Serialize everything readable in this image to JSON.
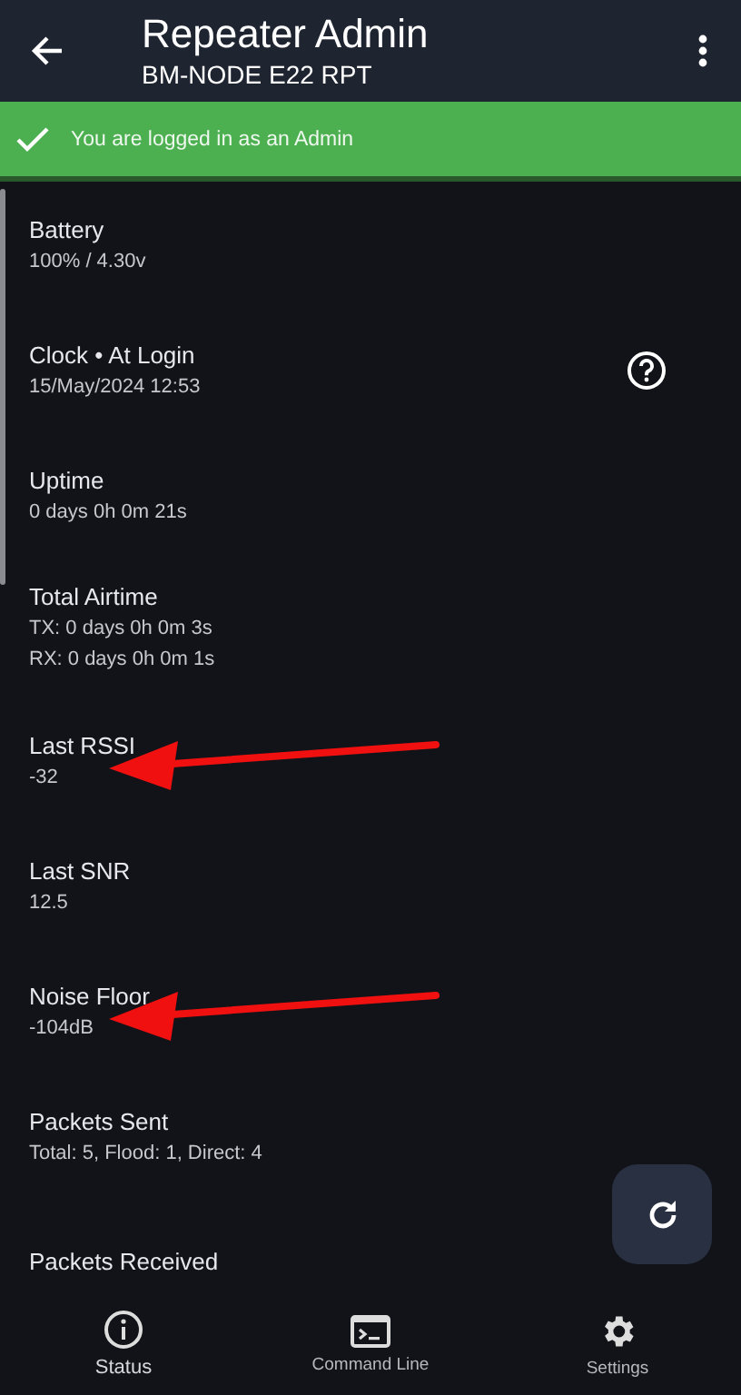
{
  "app_bar": {
    "title": "Repeater Admin",
    "subtitle": "BM-NODE E22 RPT"
  },
  "banner": {
    "text": "You are logged in as an Admin"
  },
  "items": [
    {
      "title": "Battery",
      "values": [
        "100% / 4.30v"
      ],
      "help": false,
      "arrow": false
    },
    {
      "title": "Clock • At Login",
      "values": [
        "15/May/2024 12:53"
      ],
      "help": true,
      "arrow": false
    },
    {
      "title": "Uptime",
      "values": [
        "0 days 0h 0m 21s"
      ],
      "help": false,
      "arrow": false
    },
    {
      "title": "Total Airtime",
      "values": [
        "TX: 0 days 0h 0m 3s",
        "RX: 0 days 0h 0m 1s"
      ],
      "help": false,
      "arrow": false
    },
    {
      "title": "Last RSSI",
      "values": [
        "-32"
      ],
      "help": false,
      "arrow": true
    },
    {
      "title": "Last SNR",
      "values": [
        "12.5"
      ],
      "help": false,
      "arrow": false
    },
    {
      "title": "Noise Floor",
      "values": [
        "-104dB"
      ],
      "help": false,
      "arrow": true
    },
    {
      "title": "Packets Sent",
      "values": [
        "Total: 5, Flood: 1, Direct: 4"
      ],
      "help": false,
      "arrow": false
    },
    {
      "title": "Packets Received",
      "help": false,
      "arrow": false
    }
  ],
  "nav": [
    {
      "kind": "info",
      "label": "Status",
      "selected": true
    },
    {
      "kind": "terminal",
      "label": "Command Line",
      "selected": false
    },
    {
      "kind": "gear",
      "label": "Settings",
      "selected": false
    }
  ]
}
